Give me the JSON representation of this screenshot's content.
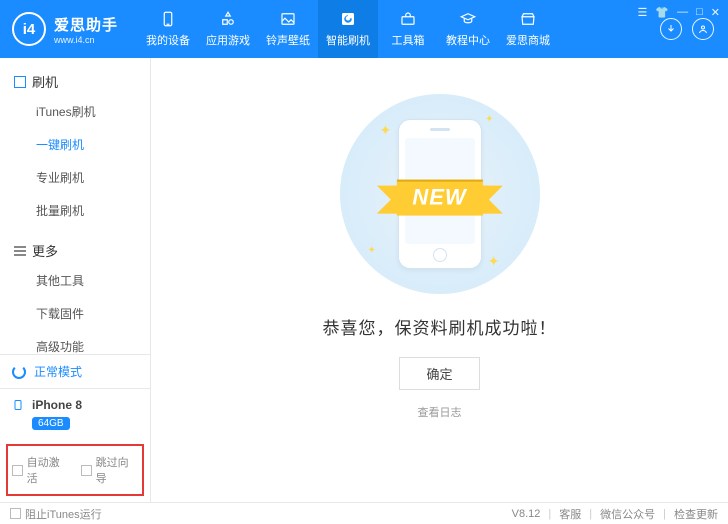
{
  "brand": {
    "name": "爱思助手",
    "site": "www.i4.cn",
    "badge": "i4"
  },
  "tabs": [
    {
      "label": "我的设备"
    },
    {
      "label": "应用游戏"
    },
    {
      "label": "铃声壁纸"
    },
    {
      "label": "智能刷机"
    },
    {
      "label": "工具箱"
    },
    {
      "label": "教程中心"
    },
    {
      "label": "爱思商城"
    }
  ],
  "sidebar": {
    "section1": "刷机",
    "items1": [
      "iTunes刷机",
      "一键刷机",
      "专业刷机",
      "批量刷机"
    ],
    "section2": "更多",
    "items2": [
      "其他工具",
      "下载固件",
      "高级功能"
    ]
  },
  "status": {
    "mode": "正常模式"
  },
  "device": {
    "name": "iPhone 8",
    "capacity": "64GB"
  },
  "checks": {
    "auto_activate": "自动激活",
    "skip_guide": "跳过向导"
  },
  "main": {
    "ribbon": "NEW",
    "title": "恭喜您，保资料刷机成功啦！",
    "confirm": "确定",
    "view_log": "查看日志"
  },
  "footer": {
    "block_itunes": "阻止iTunes运行",
    "version": "V8.12",
    "support": "客服",
    "wechat": "微信公众号",
    "check_update": "检查更新"
  }
}
